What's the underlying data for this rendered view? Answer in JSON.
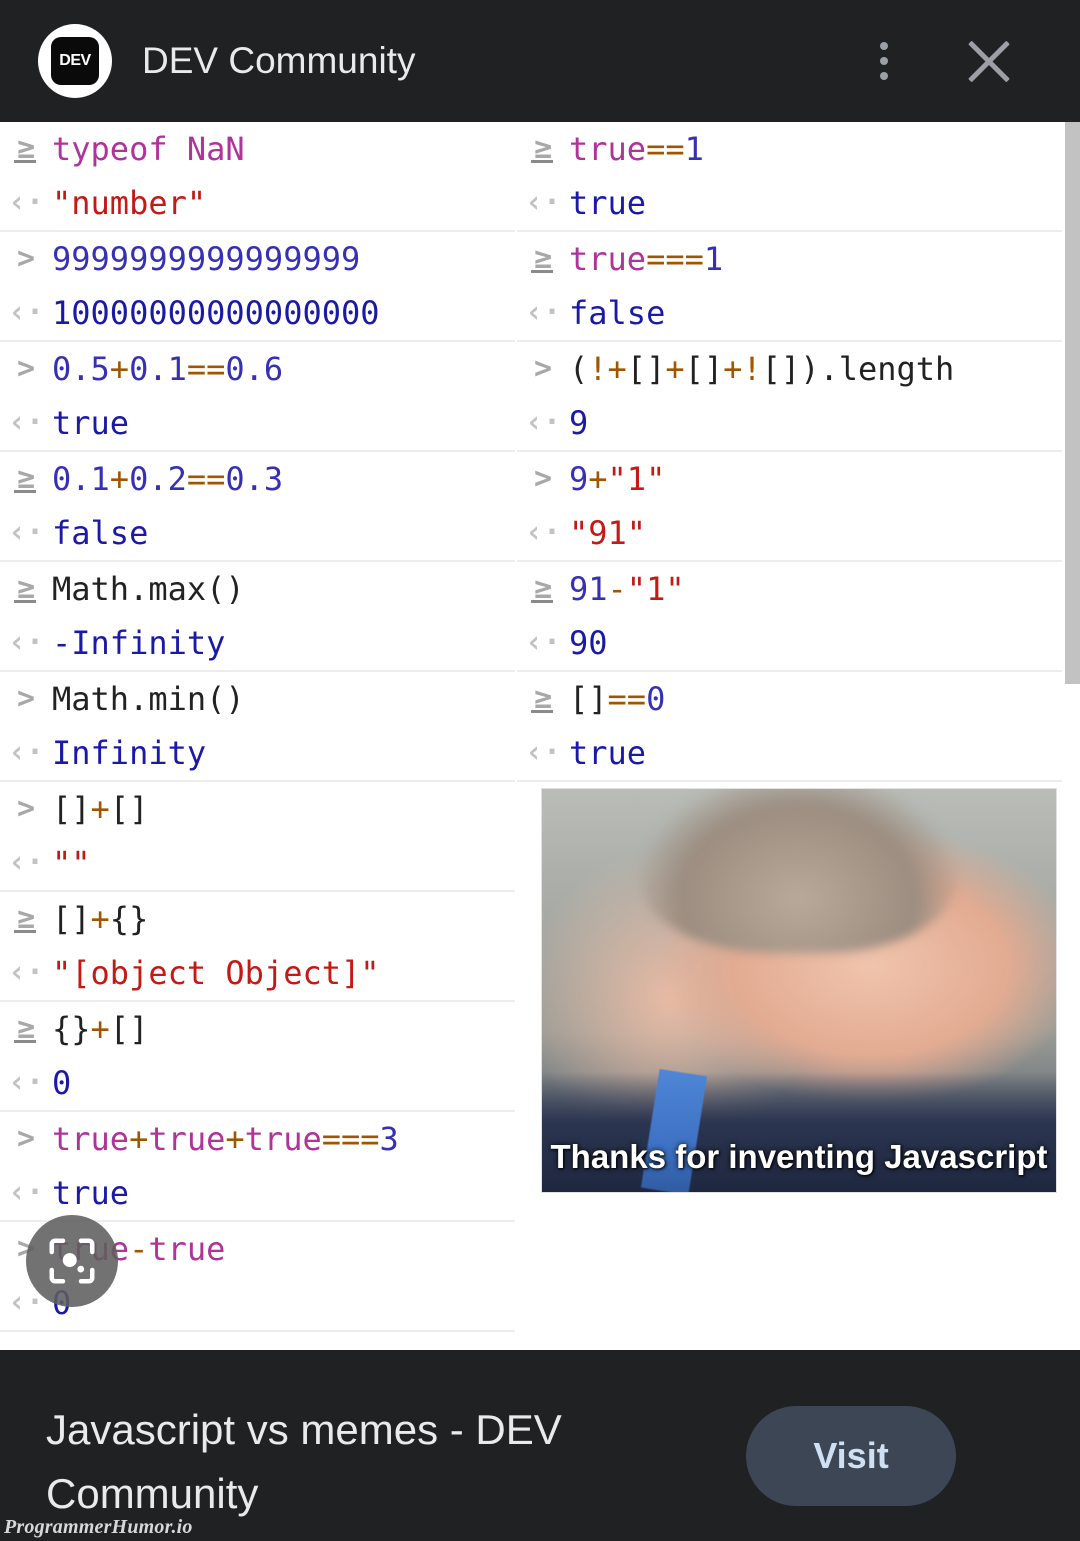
{
  "appbar": {
    "favicon_text": "DEV",
    "title": "DEV Community",
    "overflow_icon": "more-vert-icon",
    "close_icon": "close-icon"
  },
  "console": {
    "left_column": [
      {
        "input": "typeof NaN",
        "output": "\"number\"",
        "in_arrow": "≥",
        "out_arrow": "‹·"
      },
      {
        "input": "9999999999999999",
        "output": "10000000000000000",
        "in_arrow": ">",
        "out_arrow": "‹·"
      },
      {
        "input": "0.5+0.1==0.6",
        "output": "true",
        "in_arrow": ">",
        "out_arrow": "‹·"
      },
      {
        "input": "0.1+0.2==0.3",
        "output": "false",
        "in_arrow": "≥",
        "out_arrow": "‹·"
      },
      {
        "input": "Math.max()",
        "output": "-Infinity",
        "in_arrow": "≥",
        "out_arrow": "‹·"
      },
      {
        "input": "Math.min()",
        "output": "Infinity",
        "in_arrow": ">",
        "out_arrow": "‹·"
      },
      {
        "input": "[]+[]",
        "output": "\"\"",
        "in_arrow": ">",
        "out_arrow": "‹·"
      },
      {
        "input": "[]+{}",
        "output": "\"[object Object]\"",
        "in_arrow": "≥",
        "out_arrow": "‹·"
      },
      {
        "input": "{}+[]",
        "output": "0",
        "in_arrow": "≥",
        "out_arrow": "‹·"
      },
      {
        "input": "true+true+true===3",
        "output": "true",
        "in_arrow": ">",
        "out_arrow": "‹·"
      },
      {
        "input": "true-true",
        "output": "0",
        "in_arrow": ">",
        "out_arrow": "‹·"
      }
    ],
    "right_column": [
      {
        "input": "true==1",
        "output": "true",
        "in_arrow": "≥",
        "out_arrow": "‹·"
      },
      {
        "input": "true===1",
        "output": "false",
        "in_arrow": "≥",
        "out_arrow": "‹·"
      },
      {
        "input": "(!+[]+[]+![]).length",
        "output": "9",
        "in_arrow": ">",
        "out_arrow": "‹·"
      },
      {
        "input": "9+\"1\"",
        "output": "\"91\"",
        "in_arrow": ">",
        "out_arrow": "‹·"
      },
      {
        "input": "91-\"1\"",
        "output": "90",
        "in_arrow": "≥",
        "out_arrow": "‹·"
      },
      {
        "input": "[]==0",
        "output": "true",
        "in_arrow": "≥",
        "out_arrow": "‹·"
      }
    ]
  },
  "meme": {
    "caption": "Thanks for inventing Javascript",
    "alt": "smiling-man-portrait"
  },
  "overlay": {
    "lens_icon": "google-lens-icon"
  },
  "bottombar": {
    "title": "Javascript vs memes - DEV Community",
    "visit_label": "Visit"
  },
  "watermark": {
    "text": "ProgrammerHumor.io"
  },
  "colors": {
    "appbar_bg": "#1f2123",
    "page_bg": "#ffffff",
    "keyword": "#b0339b",
    "number": "#3730b5",
    "string": "#c41a16",
    "operator": "#a15500",
    "value": "#1a1aa6",
    "visit_button": "#3c4654",
    "scrollbar": "#c2c2c2"
  }
}
